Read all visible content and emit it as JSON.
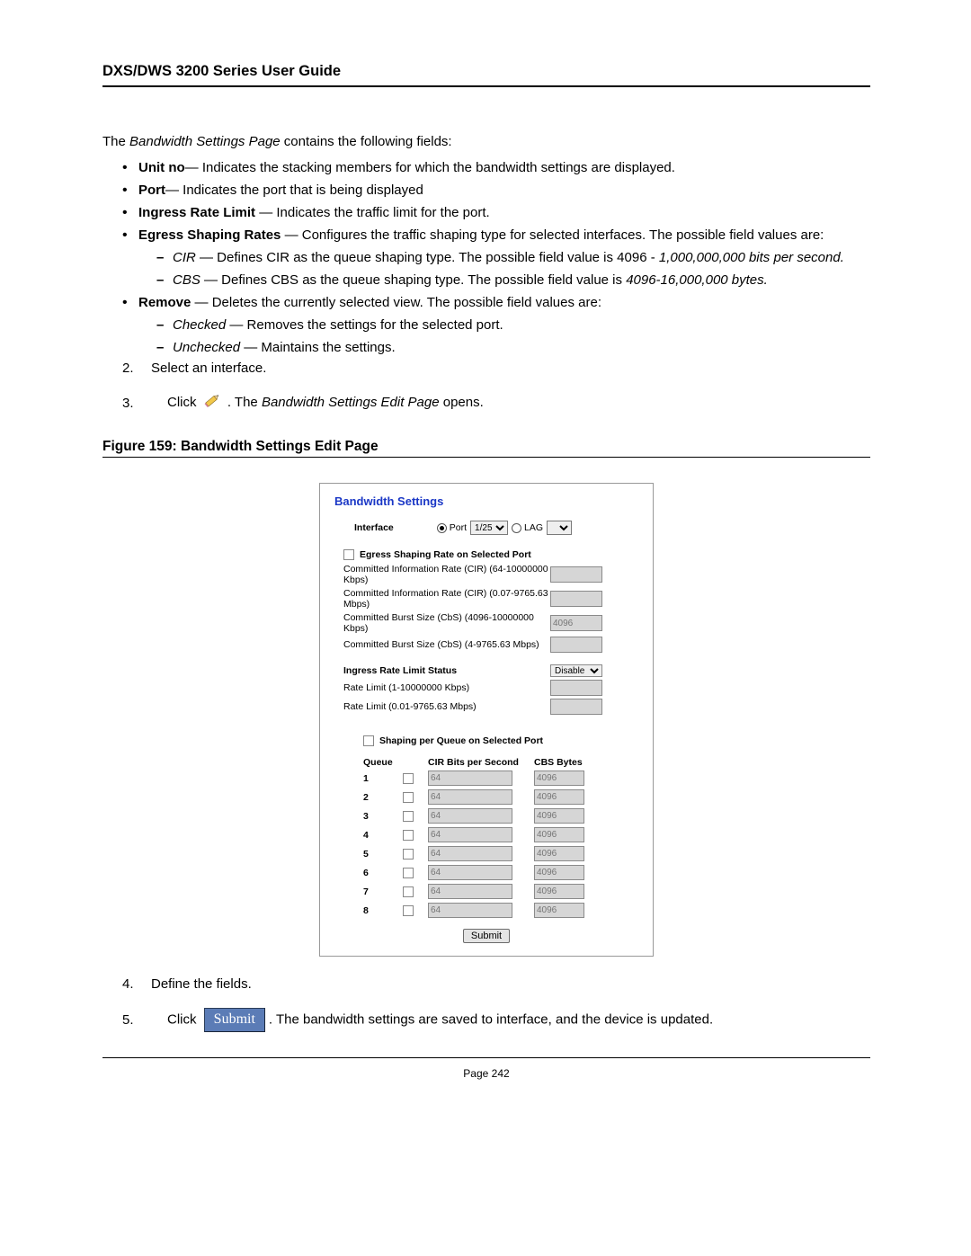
{
  "header": {
    "title": "DXS/DWS 3200 Series User Guide"
  },
  "intro": {
    "prefix": "The ",
    "page_name": "Bandwidth Settings Page",
    "suffix": " contains the following fields:"
  },
  "fields": {
    "unit_no": {
      "term": "Unit no",
      "desc": "—  Indicates the stacking members for which the bandwidth settings are displayed."
    },
    "port": {
      "term": "Port",
      "desc": "— Indicates the port that is being displayed"
    },
    "ingress": {
      "term": "Ingress Rate Limit ",
      "desc": "— Indicates the traffic limit for the port."
    },
    "egress": {
      "term": "Egress Shaping Rates ",
      "desc": "— Configures the traffic shaping type for selected interfaces. The possible field values are:"
    },
    "cir": {
      "term": "CIR",
      "mid": " — Defines CIR as the queue shaping type. The possible field value is 4096 - ",
      "val": "1,000,000,000 bits per second."
    },
    "cbs": {
      "term": "CBS",
      "mid": " — Defines CBS as the queue shaping type. The possible field value is ",
      "val": "4096-16,000,000 bytes."
    },
    "remove": {
      "term": "Remove ",
      "desc": "— Deletes the currently selected view. The possible field values are:"
    },
    "checked": {
      "term": "Checked",
      "desc": " — Removes the settings for the selected port."
    },
    "unchecked": {
      "term": "Unchecked",
      "desc": " — Maintains the settings."
    }
  },
  "steps": {
    "s2": "Select an interface.",
    "s3_prefix": "Click ",
    "s3_mid": " . The ",
    "s3_page": "Bandwidth Settings Edit Page",
    "s3_suffix": " opens.",
    "s4": "Define the fields.",
    "s5_prefix": "Click ",
    "s5_button": "Submit",
    "s5_suffix": ". The bandwidth settings are saved to interface, and the device is updated."
  },
  "figure": {
    "caption": "Figure 159: Bandwidth Settings Edit Page"
  },
  "scr": {
    "title": "Bandwidth Settings",
    "interface_label": "Interface",
    "port_label": "Port",
    "port_value": "1/25",
    "lag_label": "LAG",
    "egress_header": "Egress Shaping Rate on Selected Port",
    "cir_kbps": "Committed Information Rate (CIR) (64-10000000 Kbps)",
    "cir_mbps": "Committed Information Rate (CIR) (0.07-9765.63 Mbps)",
    "cbs_kbps": "Committed Burst Size (CbS) (4096-10000000 Kbps)",
    "cbs_mbps": "Committed Burst Size (CbS) (4-9765.63 Mbps)",
    "ingress_status": "Ingress Rate Limit Status",
    "ingress_status_value": "Disable",
    "rate_limit_kbps": "Rate Limit  (1-10000000 Kbps)",
    "rate_limit_mbps": "Rate Limit  (0.01-9765.63 Mbps)",
    "shaping_header": "Shaping per Queue on Selected Port",
    "col_queue": "Queue",
    "col_cir": "CIR  Bits per Second",
    "col_cbs": "CBS  Bytes",
    "queues": [
      "1",
      "2",
      "3",
      "4",
      "5",
      "6",
      "7",
      "8"
    ],
    "cir_placeholder": "64",
    "cbs_placeholder": "4096",
    "submit": "Submit"
  },
  "footer": {
    "page": "Page 242"
  }
}
